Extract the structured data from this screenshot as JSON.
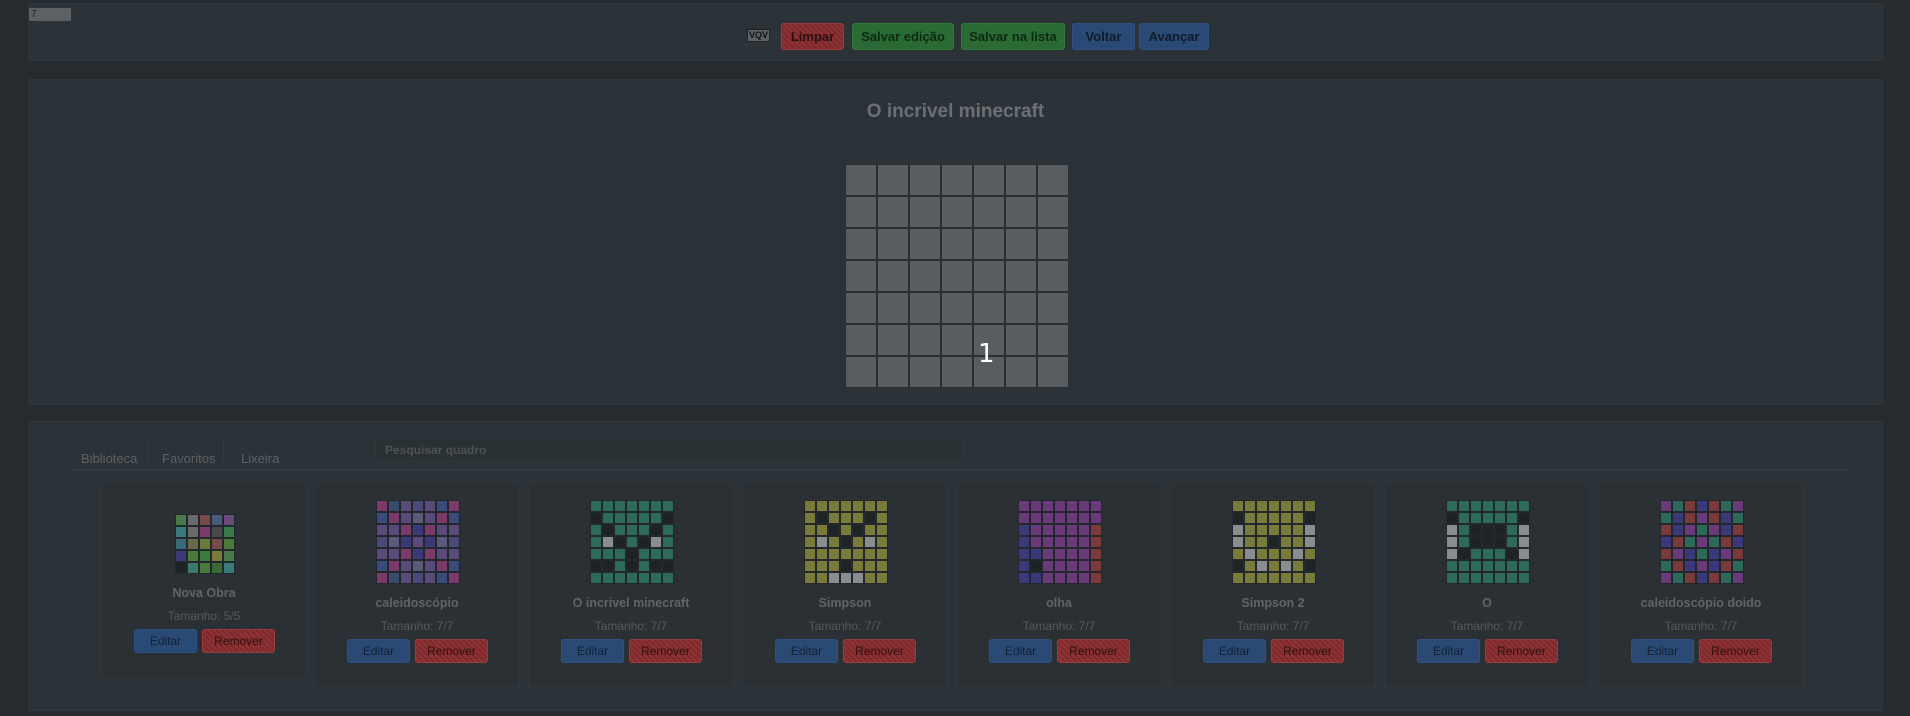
{
  "toolbar": {
    "size_value": "7",
    "color_label": "VQV",
    "buttons": {
      "clear": "Limpar",
      "save_edit": "Salvar edição",
      "save_list": "Salvar na lista",
      "back": "Voltar",
      "forward": "Avançar"
    }
  },
  "editor": {
    "title": "O incrivel minecraft",
    "cursor_number": "1",
    "grid_size": 7
  },
  "library": {
    "tabs": [
      "Biblioteca",
      "Favoritos",
      "Lixeira"
    ],
    "search_placeholder": "Pesquisar quadro",
    "edit_label": "Editar",
    "remove_label": "Remover",
    "cards": [
      {
        "name": "Nova Obra",
        "size": "Tamanho: 5/5",
        "dim": 5,
        "pixels": [
          "#4a7a4a",
          "#6a6a6a",
          "#7a4a4a",
          "#4a5a7a",
          "#6a4a7a",
          "#3a7a7a",
          "#6a6a6a",
          "#7a3a6a",
          "#4a4a4a",
          "#3a7a4a",
          "#3a6a7a",
          "#6a6a4a",
          "#6a7a3a",
          "#7a4a4a",
          "#4a7a3a",
          "#3a3a7a",
          "#4a7a3a",
          "#3a7a3a",
          "#7a7a3a",
          "#4a7a4a",
          "#1e2326",
          "#3a7a6a",
          "#4a7a3a",
          "#3a6a3a",
          "#3a7a7a"
        ]
      },
      {
        "name": "caleidoscópio",
        "size": "Tamanho: 7/7",
        "dim": 7,
        "palette": "kal"
      },
      {
        "name": "O incrivel minecraft",
        "size": "Tamanho: 7/7",
        "dim": 7,
        "palette": "mine"
      },
      {
        "name": "Simpson",
        "size": "Tamanho: 7/7",
        "dim": 7,
        "palette": "simp"
      },
      {
        "name": "olha",
        "size": "Tamanho: 7/7",
        "dim": 7,
        "palette": "olha"
      },
      {
        "name": "Simpson 2",
        "size": "Tamanho: 7/7",
        "dim": 7,
        "palette": "simp2"
      },
      {
        "name": "O",
        "size": "Tamanho: 7/7",
        "dim": 7,
        "palette": "o"
      },
      {
        "name": "caleidoscópio doido",
        "size": "Tamanho: 7/7",
        "dim": 7,
        "palette": "doido"
      }
    ]
  },
  "colors": {
    "background": "#252b2e",
    "panel": "#2c3338",
    "cell": "#585d62",
    "red_button": "#8f3235",
    "green_button": "#2a6a34",
    "blue_button": "#2a4a75"
  }
}
